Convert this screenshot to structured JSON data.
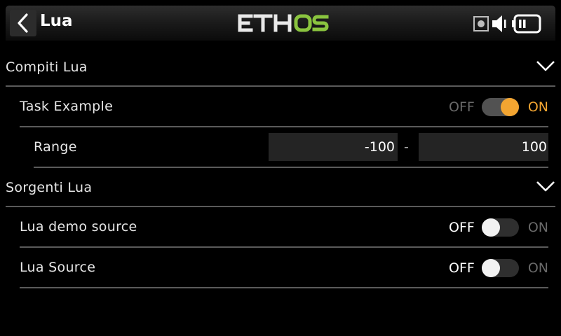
{
  "header": {
    "title": "Lua",
    "logo_prefix": "ETH",
    "logo_suffix": "OS",
    "logo_prefix_color": "#e9e9e9",
    "logo_suffix_color": "#8ac43f"
  },
  "status_icons": [
    "sd-card-icon",
    "speaker-icon",
    "battery-icon"
  ],
  "sections": {
    "tasks": {
      "title": "Compiti Lua",
      "expanded": true,
      "item": {
        "label": "Task Example",
        "toggle": {
          "off_label": "OFF",
          "on_label": "ON",
          "state": "on"
        },
        "range": {
          "label": "Range",
          "min": "-100",
          "separator": "-",
          "max": "100"
        }
      }
    },
    "sources": {
      "title": "Sorgenti Lua",
      "expanded": true,
      "items": [
        {
          "label": "Lua demo source",
          "toggle": {
            "off_label": "OFF",
            "on_label": "ON",
            "state": "off"
          }
        },
        {
          "label": "Lua Source",
          "toggle": {
            "off_label": "OFF",
            "on_label": "ON",
            "state": "off"
          }
        }
      ]
    }
  },
  "colors": {
    "accent": "#f3a531",
    "separator": "#5a5a5a",
    "field_bg": "#242424"
  }
}
